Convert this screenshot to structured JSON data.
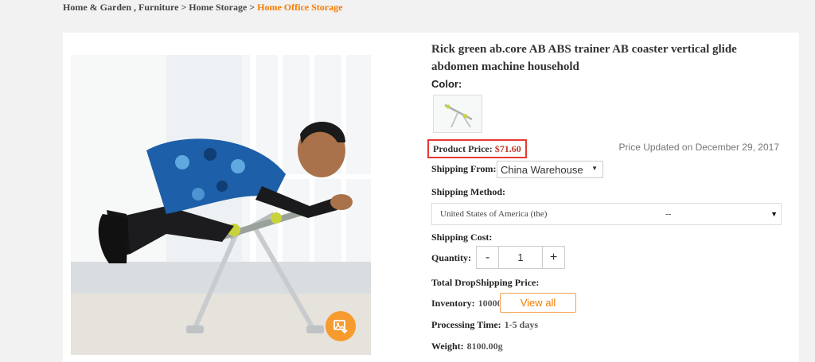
{
  "breadcrumb": {
    "items": [
      "Home & Garden",
      "Furniture",
      "Home Storage"
    ],
    "current": "Home Office Storage"
  },
  "product": {
    "title": "Rick green ab.core AB ABS trainer AB coaster vertical glide abdomen machine household",
    "color_label": "Color:",
    "price_label": "Product Price:",
    "price": "$71.60",
    "price_updated": "Price Updated on December 29, 2017",
    "shipping_from_label": "Shipping From:",
    "shipping_from_value": "China Warehouse",
    "shipping_method_label": "Shipping Method:",
    "shipping_country": "United States of America (the)",
    "shipping_method_value": "--",
    "shipping_cost_label": "Shipping Cost:",
    "quantity_label": "Quantity:",
    "quantity_value": "1",
    "minus_label": "-",
    "plus_label": "+",
    "total_label": "Total DropShipping Price:",
    "inventory_label": "Inventory:",
    "inventory_value": "10000",
    "view_all_label": "View all",
    "processing_label": "Processing Time:",
    "processing_value": "1-5 days",
    "weight_label": "Weight:",
    "weight_value": "8100.00g"
  },
  "colors": {
    "accent": "#f57c00",
    "price_border": "#e53935",
    "image_action": "#f79b2e"
  },
  "icons": [
    "image-download-icon",
    "chevron-down-icon"
  ]
}
